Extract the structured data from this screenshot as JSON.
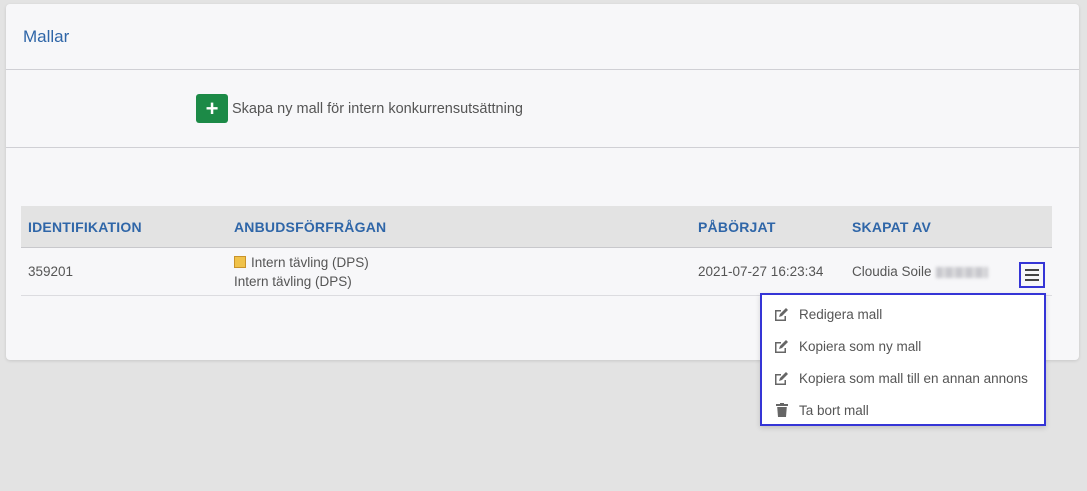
{
  "panel": {
    "title": "Mallar",
    "create_label": "Skapa ny mall för intern konkurrensutsättning"
  },
  "table": {
    "headers": {
      "identification": "IDENTIFIKATION",
      "request": "ANBUDSFÖRFRÅGAN",
      "started": "PÅBÖRJAT",
      "created_by": "SKAPAT AV"
    },
    "rows": [
      {
        "id": "359201",
        "request_title": "Intern tävling (DPS)",
        "request_subtitle": "Intern tävling (DPS)",
        "started": "2021-07-27 16:23:34",
        "created_by": "Cloudia Soile"
      }
    ]
  },
  "menu": {
    "icon": "hamburger-icon",
    "items": [
      {
        "label": "Redigera mall",
        "icon": "edit-icon"
      },
      {
        "label": "Kopiera som ny mall",
        "icon": "edit-icon"
      },
      {
        "label": "Kopiera som mall till en annan annons",
        "icon": "edit-icon"
      },
      {
        "label": "Ta bort mall",
        "icon": "trash-icon"
      }
    ]
  },
  "colors": {
    "accent": "#2f66a8",
    "create_button": "#1c8a47",
    "focus_outline": "#3535d6"
  }
}
